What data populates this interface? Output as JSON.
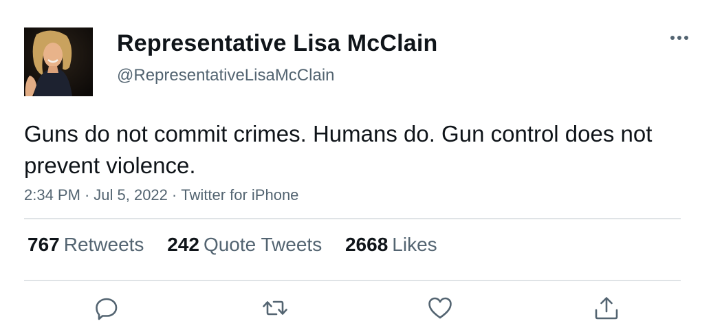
{
  "author": {
    "display_name": "Representative Lisa McClain",
    "handle": "@RepresentativeLisaMcClain",
    "avatar_icon": "profile-photo"
  },
  "tweet": {
    "text": "Guns do not commit crimes. Humans do. Gun control does not prevent violence.",
    "time": "2:34 PM",
    "date": "Jul 5, 2022",
    "source": "Twitter for iPhone",
    "separator": "·"
  },
  "stats": [
    {
      "count": "767",
      "label": "Retweets"
    },
    {
      "count": "242",
      "label": "Quote Tweets"
    },
    {
      "count": "2668",
      "label": "Likes"
    }
  ],
  "actions": [
    "reply-icon",
    "retweet-icon",
    "like-icon",
    "share-icon"
  ],
  "colors": {
    "text": "#0f1419",
    "secondary": "#536471",
    "divider": "#dfe3e6"
  }
}
